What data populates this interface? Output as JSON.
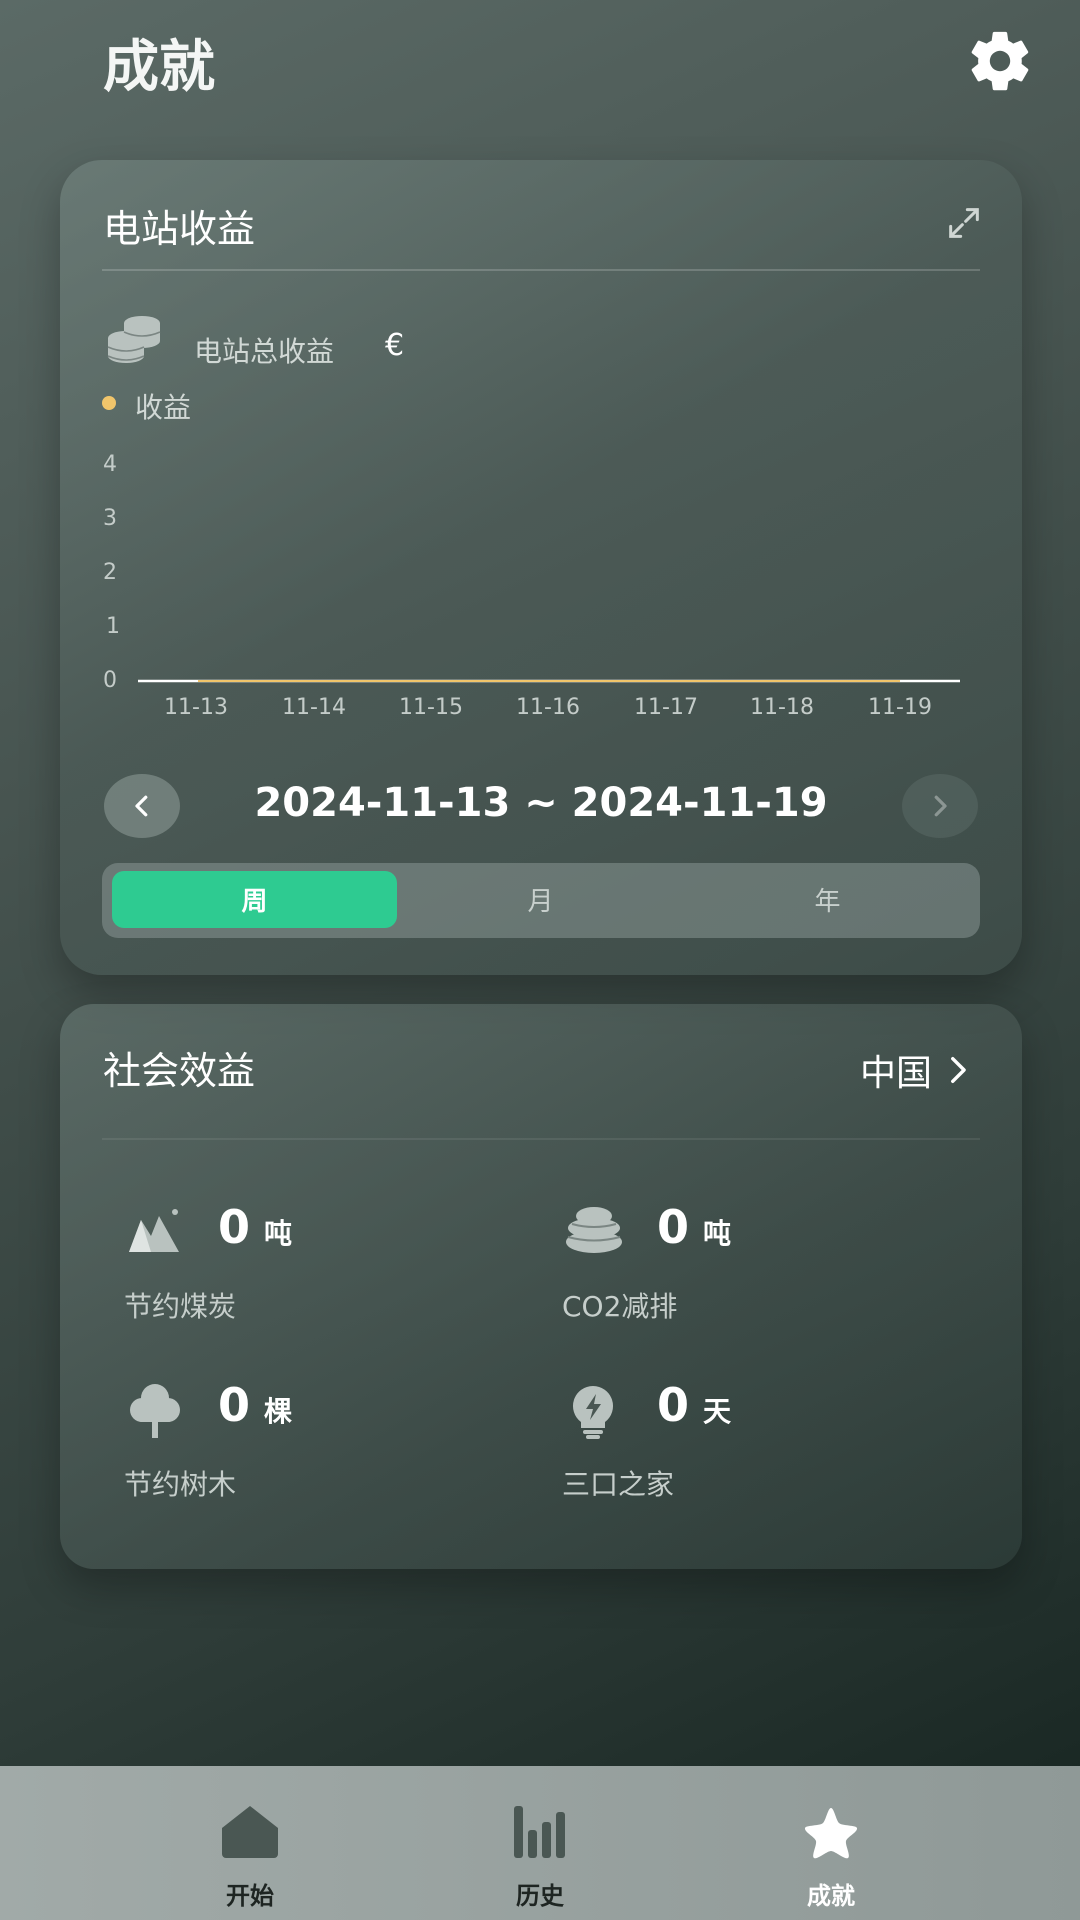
{
  "header": {
    "title": "成就"
  },
  "earnings_card": {
    "title": "电站收益",
    "total_label": "电站总收益",
    "currency": "€",
    "legend": "收益",
    "legend_color": "#f1c56b",
    "date_range": "2024-11-13 ~ 2024-11-19",
    "segments": [
      "周",
      "月",
      "年"
    ],
    "active_segment": "周"
  },
  "chart_data": {
    "type": "line",
    "x": [
      "11-13",
      "11-14",
      "11-15",
      "11-16",
      "11-17",
      "11-18",
      "11-19"
    ],
    "series": [
      {
        "name": "收益",
        "values": [
          0,
          0,
          0,
          0,
          0,
          0,
          0
        ]
      }
    ],
    "yticks": [
      "0",
      "1",
      "2",
      "3",
      "4"
    ],
    "ylim": [
      0,
      4
    ]
  },
  "social_card": {
    "title": "社会效益",
    "region": "中国",
    "stats": [
      {
        "value": "0",
        "unit": "吨",
        "label": "节约煤炭",
        "icon": "mountain-coal-icon"
      },
      {
        "value": "0",
        "unit": "吨",
        "label": "CO2减排",
        "icon": "cloud-icon"
      },
      {
        "value": "0",
        "unit": "棵",
        "label": "节约树木",
        "icon": "tree-icon"
      },
      {
        "value": "0",
        "unit": "天",
        "label": "三口之家",
        "icon": "lightbulb-icon"
      }
    ]
  },
  "tabbar": {
    "tabs": [
      {
        "label": "开始",
        "icon": "home-icon"
      },
      {
        "label": "历史",
        "icon": "bar-chart-icon"
      },
      {
        "label": "成就",
        "icon": "star-icon"
      }
    ],
    "active": "成就"
  }
}
